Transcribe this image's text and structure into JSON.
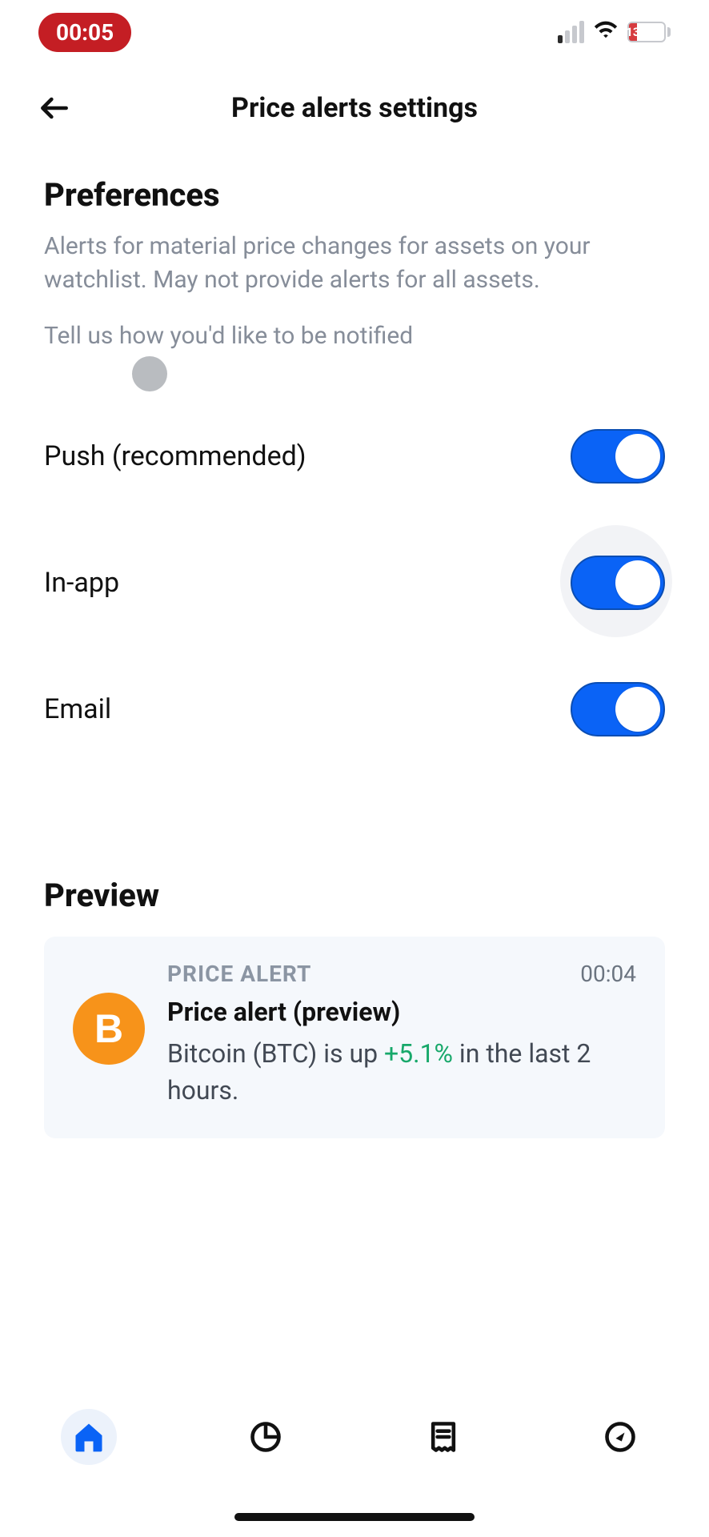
{
  "status": {
    "time": "00:05",
    "battery_percent": "13",
    "battery_fill_pct": 22,
    "battery_charging": true
  },
  "header": {
    "title": "Price alerts settings"
  },
  "preferences": {
    "title": "Preferences",
    "description": "Alerts for material price changes for assets on your watchlist. May not provide alerts for all assets.",
    "subtext": "Tell us how you'd like to be notified",
    "options": [
      {
        "label": "Push (recommended)",
        "enabled": true
      },
      {
        "label": "In-app",
        "enabled": true
      },
      {
        "label": "Email",
        "enabled": true
      }
    ]
  },
  "preview": {
    "title": "Preview",
    "card": {
      "tag": "PRICE ALERT",
      "time": "00:04",
      "headline": "Price alert (preview)",
      "asset_symbol": "B",
      "text_prefix": "Bitcoin (BTC) is up ",
      "pct": "+5.1%",
      "text_suffix": " in the last 2 hours."
    }
  },
  "tabs": {
    "items": [
      "home",
      "pie",
      "receipt",
      "compass"
    ],
    "active_index": 0
  },
  "colors": {
    "accent": "#0a63f6",
    "positive": "#17a86a",
    "bitcoin": "#f7931a",
    "time_pill": "#c41e24"
  }
}
